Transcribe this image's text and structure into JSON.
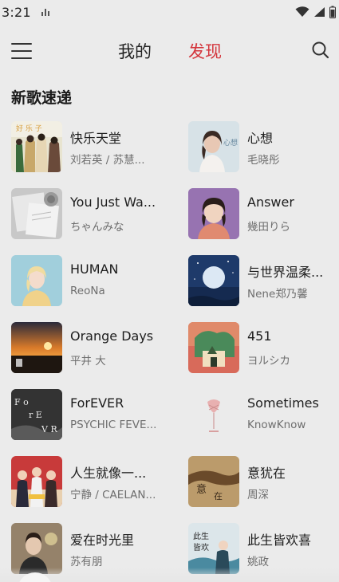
{
  "status_bar": {
    "time": "3:21"
  },
  "header": {
    "tabs": [
      {
        "label": "我的",
        "active": false
      },
      {
        "label": "发现",
        "active": true
      }
    ],
    "accent_color": "#d4363d"
  },
  "section": {
    "title": "新歌速递"
  },
  "songs": [
    {
      "title": "快乐天堂",
      "artist": "刘若英 / 苏慧..."
    },
    {
      "title": "心想",
      "artist": "毛晓彤"
    },
    {
      "title": "You Just Wa...",
      "artist": "ちゃんみな"
    },
    {
      "title": "Answer",
      "artist": "幾田りら"
    },
    {
      "title": "HUMAN",
      "artist": "ReoNa"
    },
    {
      "title": "与世界温柔...",
      "artist": "Nene郑乃馨"
    },
    {
      "title": "Orange Days",
      "artist": "平井 大"
    },
    {
      "title": "451",
      "artist": "ヨルシカ"
    },
    {
      "title": "ForEVER",
      "artist": "PSYCHIC FEVE..."
    },
    {
      "title": "Sometimes",
      "artist": "KnowKnow"
    },
    {
      "title": "人生就像一...",
      "artist": "宁静 / CAELAN..."
    },
    {
      "title": "意犹在",
      "artist": "周深"
    },
    {
      "title": "爱在时光里",
      "artist": "苏有朋"
    },
    {
      "title": "此生皆欢喜",
      "artist": "姚政"
    }
  ]
}
